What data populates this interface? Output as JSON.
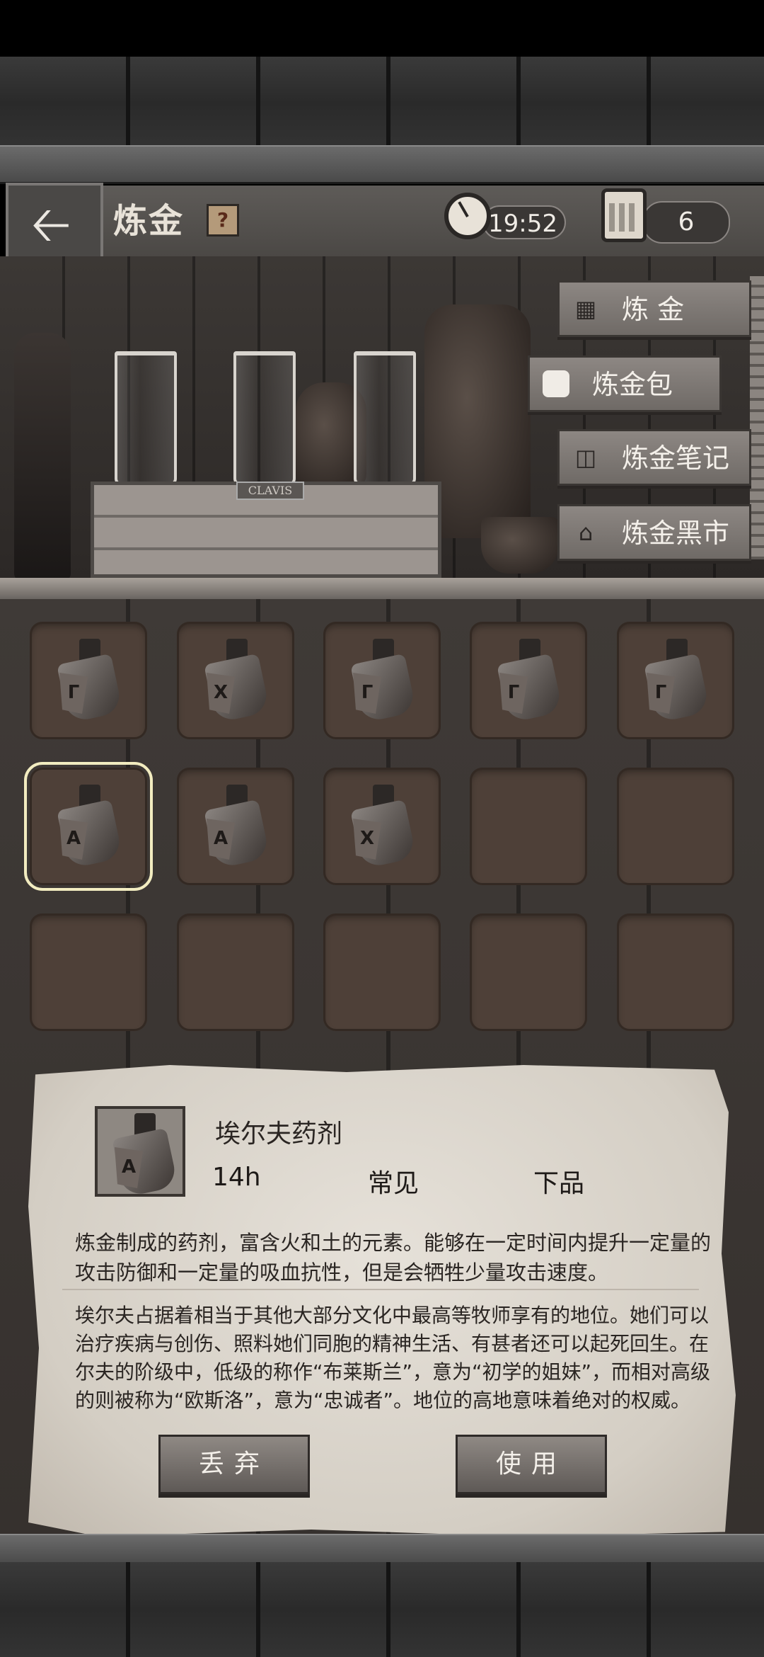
{
  "header": {
    "title": "炼金",
    "help_label": "?",
    "timer": "19:52",
    "day": "6"
  },
  "scene": {
    "crate_label": "CLAVIS"
  },
  "side_menu": [
    {
      "label": "炼 金",
      "icon": "mortar-icon"
    },
    {
      "label": "炼金包",
      "icon": "backpack-icon"
    },
    {
      "label": "炼金笔记",
      "icon": "book-icon"
    },
    {
      "label": "炼金黑市",
      "icon": "house-icon"
    }
  ],
  "inventory": {
    "slots": [
      {
        "filled": true,
        "rune": "Γ"
      },
      {
        "filled": true,
        "rune": "X"
      },
      {
        "filled": true,
        "rune": "Γ"
      },
      {
        "filled": true,
        "rune": "Γ"
      },
      {
        "filled": true,
        "rune": "Γ"
      },
      {
        "filled": true,
        "rune": "A",
        "selected": true
      },
      {
        "filled": true,
        "rune": "A"
      },
      {
        "filled": true,
        "rune": "X"
      },
      {
        "filled": false
      },
      {
        "filled": false
      },
      {
        "filled": false
      },
      {
        "filled": false
      },
      {
        "filled": false
      },
      {
        "filled": false
      },
      {
        "filled": false
      }
    ]
  },
  "detail": {
    "name": "埃尔夫药剂",
    "duration": "14h",
    "rarity": "常见",
    "grade": "下品",
    "rune": "A",
    "description": "炼金制成的药剂，富含火和土的元素。能够在一定时间内提升一定量的攻击防御和一定量的吸血抗性，但是会牺牲少量攻击速度。",
    "lore": "埃尔夫占据着相当于其他大部分文化中最高等牧师享有的地位。她们可以治疗疾病与创伤、照料她们同胞的精神生活、有甚者还可以起死回生。在尔夫的阶级中，低级的称作“布莱斯兰”，意为“初学的姐妹”，而相对高级的则被称为“欧斯洛”，意为“忠诚者”。地位的高地意味着绝对的权威。",
    "discard_label": "丢弃",
    "use_label": "使用"
  }
}
